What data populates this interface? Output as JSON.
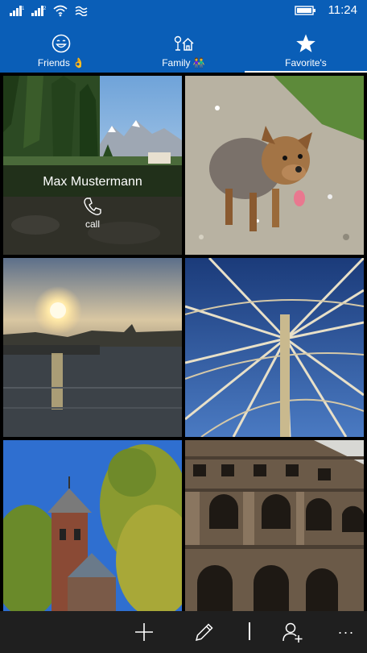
{
  "status_bar": {
    "time": "11:24",
    "icons": [
      "signal-1-icon",
      "signal-2-icon",
      "wifi-icon",
      "data-icon",
      "battery-icon"
    ]
  },
  "tabs": [
    {
      "label": "Friends 👌",
      "icon": "smiley-icon",
      "active": false
    },
    {
      "label": "Family 👫",
      "icon": "family-house-icon",
      "active": false
    },
    {
      "label": "Favorite's",
      "icon": "star-icon",
      "active": true
    }
  ],
  "tiles": [
    {
      "photo": "mountain-forest-lake",
      "contact_name": "Max Mustermann",
      "action_label": "call"
    },
    {
      "photo": "small-dog-on-gravel"
    },
    {
      "photo": "sunset-over-river"
    },
    {
      "photo": "ferris-wheel-from-below"
    },
    {
      "photo": "church-tower-and-trees"
    },
    {
      "photo": "colosseum-arches"
    }
  ],
  "app_bar": {
    "buttons": [
      "add-icon",
      "edit-icon",
      "add-contact-icon",
      "more-icon"
    ],
    "more_label": "···"
  },
  "colors": {
    "accent": "#0a5eb7",
    "app_bar": "#1f1f1f"
  }
}
